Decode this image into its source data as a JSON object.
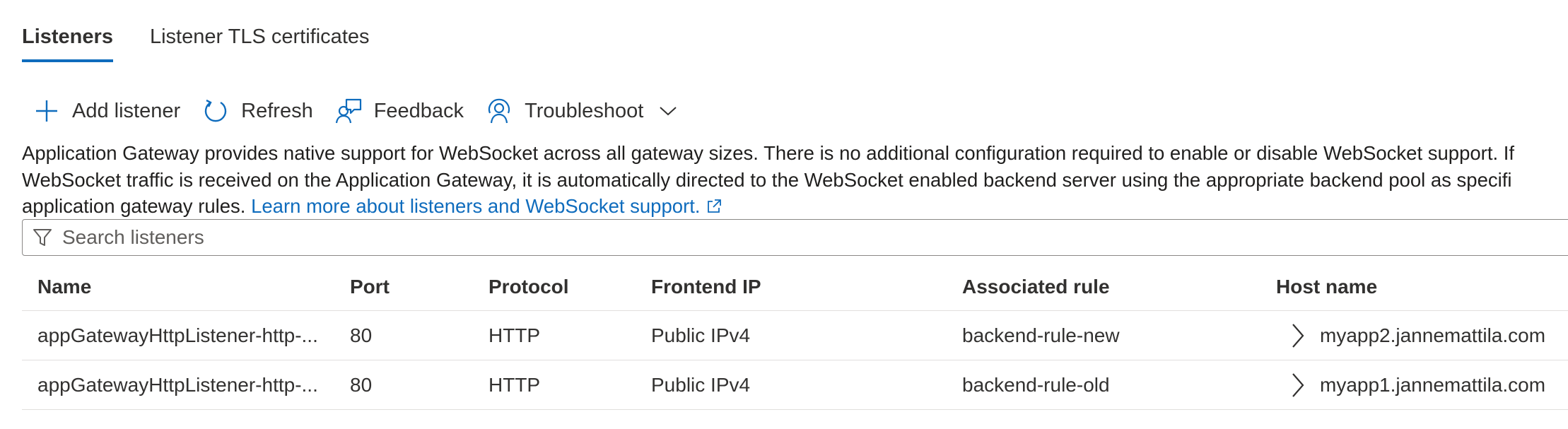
{
  "tabs": [
    {
      "label": "Listeners",
      "active": true
    },
    {
      "label": "Listener TLS certificates",
      "active": false
    }
  ],
  "toolbar": {
    "add_label": "Add listener",
    "refresh_label": "Refresh",
    "feedback_label": "Feedback",
    "troubleshoot_label": "Troubleshoot"
  },
  "info": {
    "line1": "Application Gateway provides native support for WebSocket across all gateway sizes. There is no additional configuration required to enable or disable WebSocket support. If",
    "line2": "WebSocket traffic is received on the Application Gateway, it is automatically directed to the WebSocket enabled backend server using the appropriate backend pool as specifi",
    "line3": "application gateway rules.",
    "link": "Learn more about listeners and WebSocket support."
  },
  "search": {
    "placeholder": "Search listeners"
  },
  "table": {
    "columns": [
      "Name",
      "Port",
      "Protocol",
      "Frontend IP",
      "Associated rule",
      "Host name"
    ],
    "rows": [
      {
        "name": "appGatewayHttpListener-http-...",
        "port": "80",
        "protocol": "HTTP",
        "frontend_ip": "Public IPv4",
        "rule": "backend-rule-new",
        "host": "myapp2.jannemattila.com"
      },
      {
        "name": "appGatewayHttpListener-http-...",
        "port": "80",
        "protocol": "HTTP",
        "frontend_ip": "Public IPv4",
        "rule": "backend-rule-old",
        "host": "myapp1.jannemattila.com"
      }
    ]
  },
  "colors": {
    "accent": "#0f6cbd",
    "text": "#323130",
    "border": "#e1dfdd"
  }
}
